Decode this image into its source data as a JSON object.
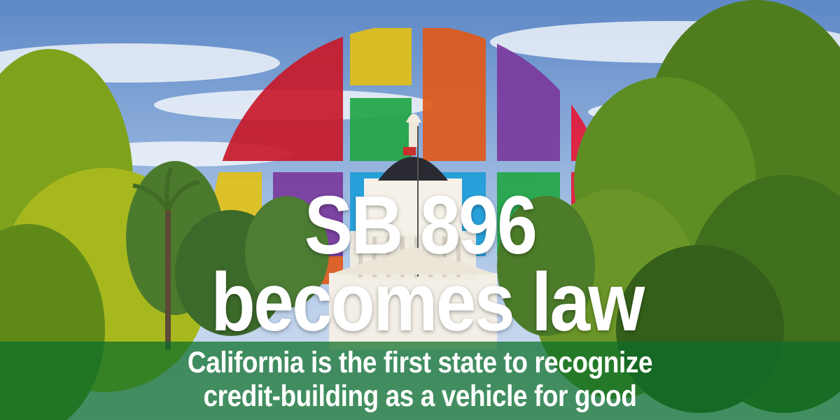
{
  "headline": {
    "line1": "SB 896",
    "line2": "becomes law"
  },
  "subtitle": {
    "line1": "California is the first state to recognize",
    "line2": "credit-building as a vehicle for good"
  },
  "logo": {
    "icon": "rainbow-grid-circle-logo",
    "colors": [
      "#d11f2e",
      "#e5c21a",
      "#e8621c",
      "#7b3a9e",
      "#24a845",
      "#1e9fd9",
      "#e31b3a"
    ]
  },
  "scene": {
    "icon": "california-state-capitol-dome",
    "sky_color": "#6f9bd0",
    "foliage_color": "#5c8a1e",
    "banner_color": "#0a6e28"
  }
}
